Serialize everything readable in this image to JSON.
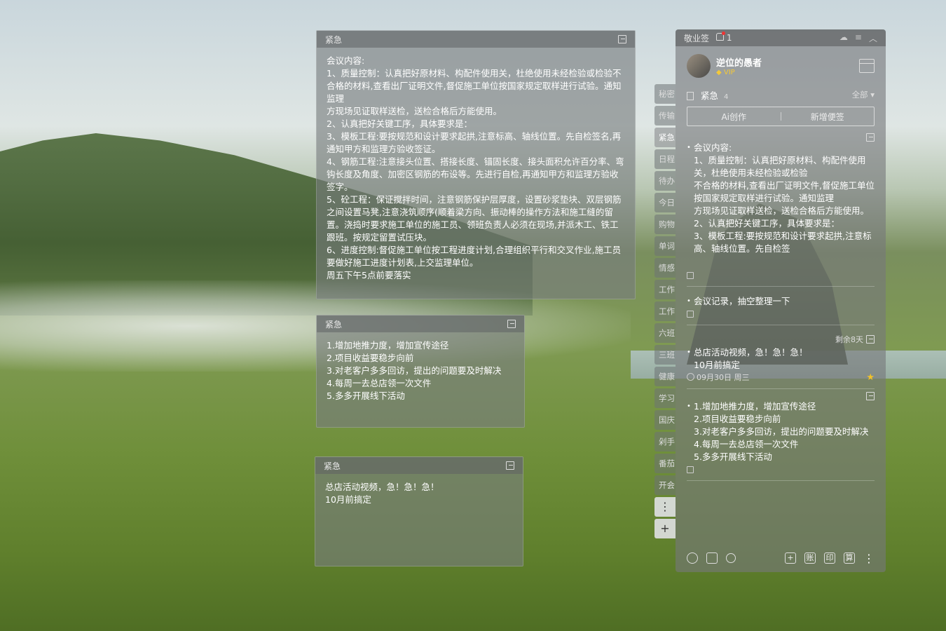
{
  "note1": {
    "tag": "紧急",
    "lines": [
      "会议内容:",
      "1、质量控制：认真把好原材料、构配件使用关，杜绝使用未经检验或检验不合格的材料,查看出厂证明文件,督促施工单位按国家规定取样进行试验。通知监理",
      "方现场见证取样送检，送检合格后方能使用。",
      "2、认真把好关键工序，具体要求是：",
      "3、模板工程:要按规范和设计要求起拱,注意标高、轴线位置。先自检签名,再通知甲方和监理方验收签证。",
      "4、钢筋工程:注意接头位置、搭接长度、锚固长度、接头面积允许百分率、弯钩长度及角度、加密区钢筋的布设等。先进行自检,再通知甲方和监理方验收签字。",
      "5、砼工程：保证搅拌时间，注意钢筋保护层厚度，设置砂浆垫块、双层钢筋之间设置马凳,注意浇筑顺序(顺着梁方向、振动棒的操作方法和施工缝的留置。浇捣时要求施工单位的施工员、领班负责人必须在现场,并派木工、铁工跟班。按规定留置试压块。",
      "6、进度控制:督促施工单位按工程进度计划,合理组织平行和交叉作业,施工员要做好施工进度计划表,上交监理单位。",
      "周五下午5点前要落实"
    ]
  },
  "note2": {
    "tag": "紧急",
    "lines": [
      "1.增加地推力度，增加宣传途径",
      "2.项目收益要稳步向前",
      "3.对老客户多多回访，提出的问题要及时解决",
      "4.每周一去总店领一次文件",
      "5.多多开展线下活动"
    ]
  },
  "note3": {
    "tag": "紧急",
    "lines": [
      "总店活动视频，急！急！急！",
      "10月前搞定"
    ]
  },
  "side_tabs": [
    "秘密",
    "传输",
    "紧急",
    "日程",
    "待办",
    "今日",
    "购物",
    "单词",
    "情感",
    "工作",
    "工作",
    "六班",
    "三班",
    "健康",
    "学习",
    "国庆",
    "剁手",
    "番茄",
    "开会"
  ],
  "side_more": "⋮",
  "side_add": "+",
  "panel": {
    "app_name": "敬业签",
    "notif_count": "1",
    "user_name": "逆位的愚者",
    "vip": "VIP",
    "category": "紧急",
    "category_count": "4",
    "filter": "全部",
    "ai_label": "Ai创作",
    "new_label": "新增便签",
    "cards": [
      {
        "text": "会议内容:\n1、质量控制：认真把好原材料、构配件使用关，杜绝使用未经检验或检验\n不合格的材料,查看出厂证明文件,督促施工单位按国家规定取样进行试验。通知监理\n方现场见证取样送检，送检合格后方能使用。\n2、认真把好关键工序，具体要求是：\n3、模板工程:要按规范和设计要求起拱,注意标高、轴线位置。先自检签"
      },
      {
        "text": "会议记录，抽空整理一下"
      },
      {
        "text": "总店活动视频，急！急！急！\n10月前搞定",
        "remain": "剩余8天",
        "date": "09月30日 周三"
      },
      {
        "text": "1.增加地推力度，增加宣传途径\n2.项目收益要稳步向前\n3.对老客户多多回访，提出的问题要及时解决\n4.每周一去总店领一次文件\n5.多多开展线下活动"
      }
    ],
    "bottom_right": [
      "+",
      "账",
      "印",
      "算"
    ],
    "bottom_more": "⋮"
  }
}
